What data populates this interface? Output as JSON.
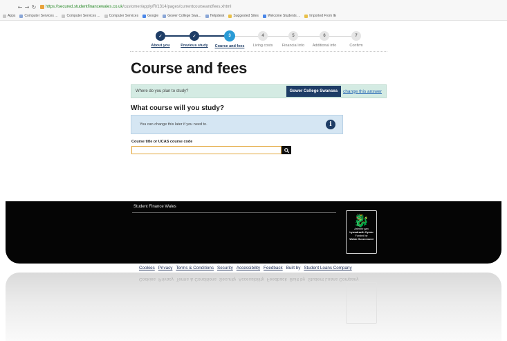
{
  "browser": {
    "url_scheme": "https://",
    "url_host": "secured.studentfinancewales.co.uk",
    "url_path": "/customer/apply/R/1314/pages/currentcourseandfees.xhtml",
    "bookmarks": [
      "Apps",
      "Computer Services ...",
      "Computer Services ...",
      "Computer Services",
      "Google",
      "Gower College Swa...",
      "Helpdesk",
      "Suggested Sites",
      "Welcome Students ...",
      "Imported From IE"
    ]
  },
  "stepper": {
    "steps": [
      {
        "number": "✓",
        "label": "About you",
        "state": "done"
      },
      {
        "number": "✓",
        "label": "Previous study",
        "state": "done"
      },
      {
        "number": "3",
        "label": "Course and fees",
        "state": "current"
      },
      {
        "number": "4",
        "label": "Living costs",
        "state": "todo"
      },
      {
        "number": "5",
        "label": "Financial info",
        "state": "todo"
      },
      {
        "number": "6",
        "label": "Additional info",
        "state": "todo"
      },
      {
        "number": "7",
        "label": "Confirm",
        "state": "todo"
      }
    ]
  },
  "page": {
    "title": "Course and fees",
    "study_question": "Where do you plan to study?",
    "college": "Gower College Swansea",
    "change_answer": "change this answer",
    "course_heading": "What course will you study?",
    "info_text": "You can change this later if you need to.",
    "info_icon": "i",
    "field_label": "Course title or UCAS course code",
    "field_value": "",
    "field_placeholder": ""
  },
  "footer": {
    "brand": "Student Finance Wales",
    "gov_lines": [
      "Ariennir gan",
      "Lywodraeth Cymru",
      "Funded by",
      "Welsh Government"
    ],
    "links": [
      "Cookies",
      "Privacy",
      "Terms & Conditions",
      "Security",
      "Accessibility",
      "Feedback"
    ],
    "built_by_prefix": "Built by",
    "built_by_link": "Student Loans Company"
  },
  "colors": {
    "navy": "#1e3d66",
    "current_step": "#2a9bd6",
    "green_panel": "#d4ebe3",
    "info_panel": "#d5e6f3",
    "input_focus": "#e3a63a"
  }
}
